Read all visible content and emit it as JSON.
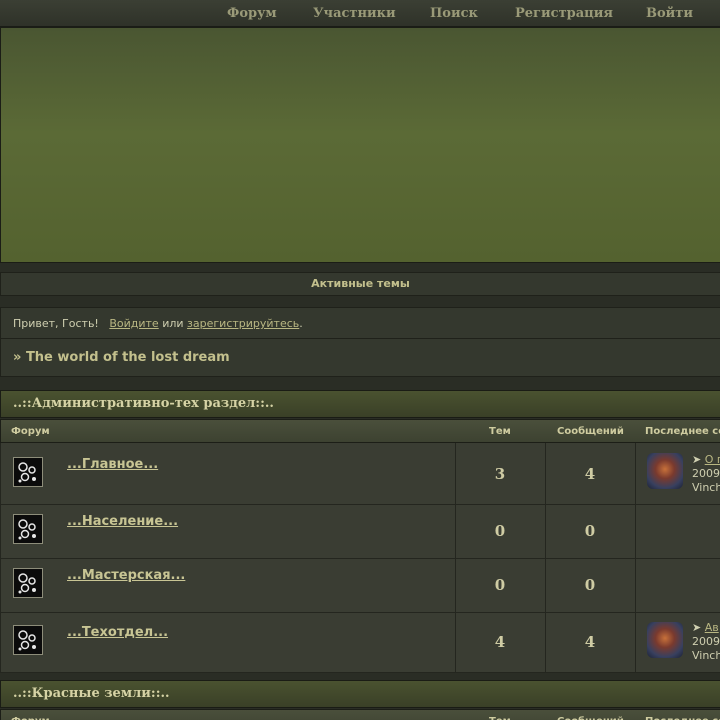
{
  "nav": {
    "items": [
      "Форум",
      "Участники",
      "Поиск",
      "Регистрация",
      "Войти"
    ]
  },
  "active_topics": "Активные темы",
  "greeting": {
    "prefix": "Привет, Гость!",
    "login_link": "Войдите",
    "or_text": "или",
    "register_link": "зарегистрируйтесь",
    "suffix": "."
  },
  "breadcrumb": {
    "arrow": "»",
    "title": "The world of the lost dream"
  },
  "columns": {
    "forum": "Форум",
    "topics": "Тем",
    "posts": "Сообщений",
    "last": "Последнее со"
  },
  "categories": [
    {
      "title": "..::Административно-тех раздел::..",
      "forums": [
        {
          "name": "...Главное...",
          "topics": "3",
          "posts": "4",
          "last_link": "О п",
          "last_date": "2009/",
          "last_user": "Vinch"
        },
        {
          "name": "...Население...",
          "topics": "0",
          "posts": "0"
        },
        {
          "name": "...Мастерская...",
          "topics": "0",
          "posts": "0"
        },
        {
          "name": "...Техотдел...",
          "topics": "4",
          "posts": "4",
          "last_link": "Ав",
          "last_date": "2009/",
          "last_user": "Vinch"
        }
      ]
    },
    {
      "title": "..::Красные земли::..",
      "forums": []
    }
  ],
  "icons": {
    "forum_icon": "forum-bubbles-icon",
    "last_post_icon": "arrow-right-icon"
  }
}
